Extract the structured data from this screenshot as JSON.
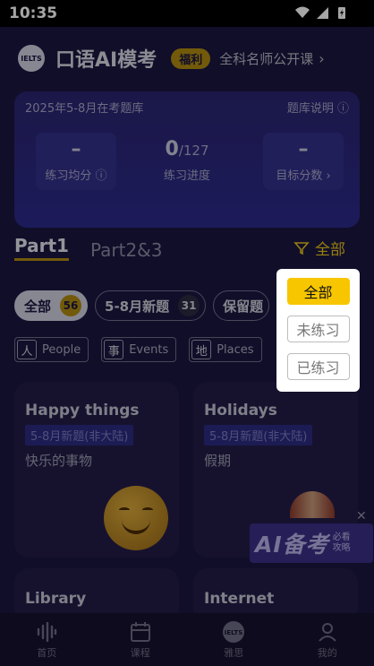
{
  "status_bar": {
    "time": "10:35"
  },
  "header": {
    "logo": "IELTS",
    "title": "口语AI模考",
    "badge": "福利",
    "link": "全科名师公开课"
  },
  "stats": {
    "bank_label": "2025年5-8月在考题库",
    "bank_info": "题库说明",
    "avg_value": "–",
    "avg_label": "练习均分",
    "progress_done": "0",
    "progress_total": "/127",
    "progress_label": "练习进度",
    "target_value": "–",
    "target_label": "目标分数"
  },
  "tabs": {
    "part1": "Part1",
    "part23": "Part2&3"
  },
  "filter": {
    "label": "全部"
  },
  "chips": [
    {
      "label": "全部",
      "count": "56"
    },
    {
      "label": "5-8月新题",
      "count": "31"
    },
    {
      "label": "保留题"
    }
  ],
  "topics": [
    {
      "char": "人",
      "label": "People"
    },
    {
      "char": "事",
      "label": "Events"
    },
    {
      "char": "地",
      "label": "Places"
    }
  ],
  "cards": [
    {
      "title": "Happy things",
      "tag": "5-8月新题(非大陆)",
      "subtitle": "快乐的事物"
    },
    {
      "title": "Holidays",
      "tag": "5-8月新题(非大陆)",
      "subtitle": "假期"
    },
    {
      "title": "Library"
    },
    {
      "title": "Internet"
    }
  ],
  "ai_banner": {
    "big": "AI备考",
    "line1": "必看",
    "line2": "攻略"
  },
  "dropdown": {
    "items": [
      "全部",
      "未练习",
      "已练习"
    ],
    "selected": "全部"
  },
  "nav": [
    "首页",
    "课程",
    "雅思",
    "我的"
  ],
  "colors": {
    "accent": "#f7c600",
    "background": "#1b1640",
    "card": "#221d48"
  }
}
